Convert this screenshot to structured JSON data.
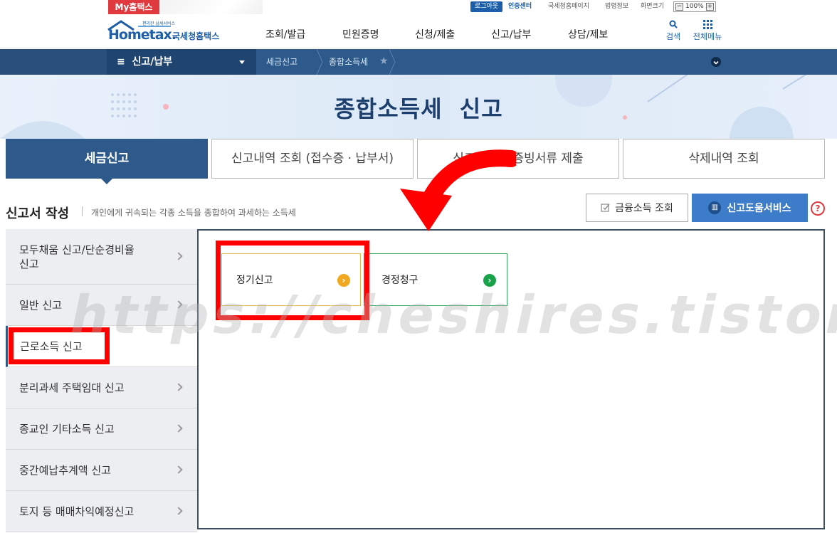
{
  "topbar": {
    "my_tab": "My홈택스",
    "logout": "로그아웃",
    "cert_center": "인증센터",
    "links": [
      "국세청홈페이지",
      "법령정보",
      "화면크기"
    ],
    "zoom": "100%",
    "zoom_minus": "−",
    "zoom_plus": "+"
  },
  "header": {
    "logo_tagline": "편리한 납세서비스",
    "logo_text": "Hometax.",
    "logo_kor": "국세청홈택스",
    "nav": [
      "조회/발급",
      "민원증명",
      "신청/제출",
      "신고/납부",
      "상담/제보"
    ],
    "search_label": "검색",
    "allmenu_label": "전체메뉴"
  },
  "location": {
    "menu": "신고/납부",
    "crumbs": [
      "세금신고",
      "종합소득세"
    ]
  },
  "hero": {
    "title": "종합소득세  신고"
  },
  "tabs": [
    {
      "label": "세금신고"
    },
    {
      "label": "신고내역 조회 (접수증 · 납부서)"
    },
    {
      "label": "신고 부속 · 증빙서류 제출"
    },
    {
      "label": "삭제내역 조회"
    }
  ],
  "section": {
    "title": "신고서 작성",
    "desc": "개인에게 귀속되는 각종 소득을 종합하여 과세하는 소득세",
    "btn_fin": "금융소득 조회",
    "btn_help": "신고도움서비스",
    "help_q": "?"
  },
  "lnb": [
    {
      "label": "모두채움 신고/단순경비율\n신고"
    },
    {
      "label": "일반 신고"
    },
    {
      "label": "근로소득 신고"
    },
    {
      "label": "분리과세 주택임대 신고"
    },
    {
      "label": "종교인 기타소득 신고"
    },
    {
      "label": "중간예납추계액 신고"
    },
    {
      "label": "토지 등 매매차익예정신고"
    }
  ],
  "options": {
    "regular": "정기신고",
    "correction": "경정청구"
  },
  "watermark": "https://cheshires.tistory.com/",
  "colors": {
    "primary": "#2d5a8a",
    "help_button": "#3d7cc9",
    "accent_red": "#ff0000",
    "regular_icon": "#f0a81e",
    "correction_icon": "#1aa24a"
  }
}
